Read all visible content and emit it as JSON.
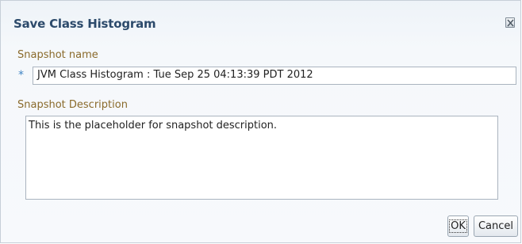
{
  "dialog": {
    "title": "Save Class Histogram",
    "close_icon": "close-x-icon"
  },
  "snapshot_name": {
    "label": "Snapshot name",
    "required_marker": "*",
    "value": "JVM Class Histogram : Tue Sep 25 04:13:39 PDT 2012"
  },
  "snapshot_description": {
    "label": "Snapshot Description",
    "value": "This is the placeholder for snapshot description."
  },
  "buttons": {
    "ok_label": "OK",
    "cancel_label": "Cancel"
  }
}
